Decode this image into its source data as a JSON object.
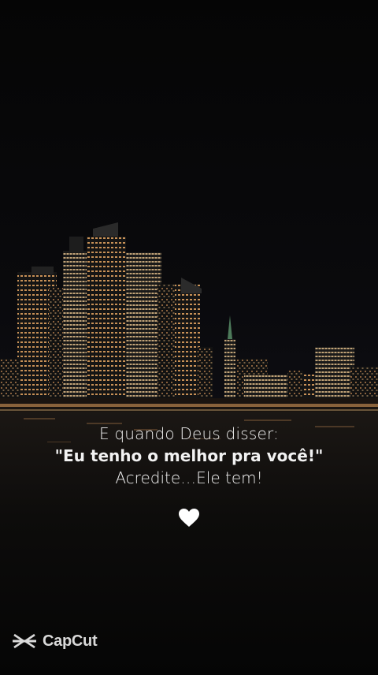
{
  "caption": {
    "line1": "E quando Deus disser:",
    "line2": "\"Eu tenho o melhor pra você!\"",
    "line3": "Acredite…Ele tem!"
  },
  "heart": {
    "icon": "white-heart-icon",
    "color": "#ffffff"
  },
  "watermark": {
    "text": "CapCut",
    "icon": "capcut-logo-icon"
  },
  "colors": {
    "background": "#070707",
    "text": "#f2f2f2",
    "city_lights": "#ffb86b"
  }
}
